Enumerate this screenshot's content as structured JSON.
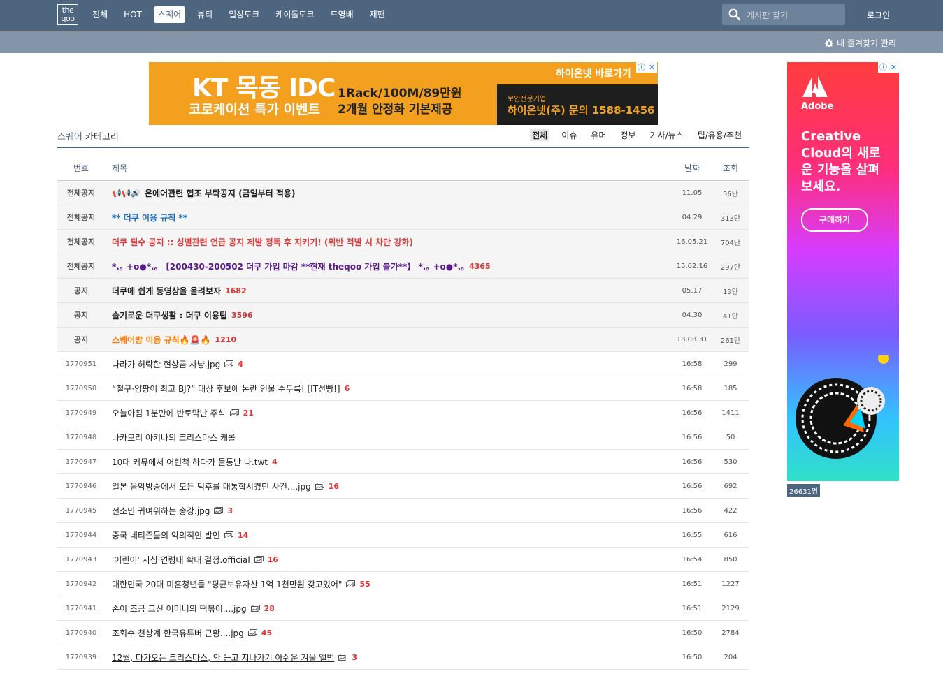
{
  "header": {
    "logo_text": "the qoo",
    "nav": [
      {
        "label": "전체",
        "active": false
      },
      {
        "label": "HOT",
        "active": false
      },
      {
        "label": "스퀘어",
        "active": true
      },
      {
        "label": "뷰티",
        "active": false
      },
      {
        "label": "일상토크",
        "active": false
      },
      {
        "label": "케이돌토크",
        "active": false
      },
      {
        "label": "드영배",
        "active": false
      },
      {
        "label": "재팬",
        "active": false
      }
    ],
    "search_placeholder": "게시판 찾기",
    "login": "로그인",
    "favorites": "내 즐겨찾기 관리"
  },
  "ad_banner": {
    "headline": "KT 목동 IDC",
    "subline": "코로케이션 특가 이벤트",
    "offer_line1": "1Rack/100M/89만원",
    "offer_line2": "2개월 안정화 기본제공",
    "goto": "하이온넷 바로가기",
    "company_tag": "보안전문기업",
    "contact": "하이온넷(주) 문의 1588-1456"
  },
  "category": {
    "title_prefix": "스퀘어",
    "title_suffix": "카테고리",
    "tabs": [
      "전체",
      "이슈",
      "유머",
      "정보",
      "기사/뉴스",
      "팁/유용/추천"
    ],
    "active_tab": "전체"
  },
  "board": {
    "columns": {
      "no": "번호",
      "title": "제목",
      "date": "날짜",
      "views": "조회"
    },
    "rows": [
      {
        "no": "전체공지",
        "notice": true,
        "prefix": "📢📢🔊",
        "title": "온에어관련 협조 부탁공지 (금일부터 적용)",
        "color": "#222",
        "bold": true,
        "img": false,
        "comments": "",
        "date": "11.05",
        "views": "56만"
      },
      {
        "no": "전체공지",
        "notice": true,
        "prefix": "",
        "title": "** 더쿠 이용 규칙 **",
        "color": "#1a6fc4",
        "bold": true,
        "img": false,
        "comments": "",
        "date": "04.29",
        "views": "313만"
      },
      {
        "no": "전체공지",
        "notice": true,
        "prefix": "",
        "title": "더쿠 필수 공지 :: 성별관련 언급 공지 제발 정독 후 지키기! (위반 적발 시 차단 강화)",
        "color": "#e03a3a",
        "bold": true,
        "img": false,
        "comments": "",
        "date": "16.05.21",
        "views": "704만"
      },
      {
        "no": "전체공지",
        "notice": true,
        "prefix": "",
        "title": "*.｡ +o●*.｡ 【200430-200502 더쿠 가입 마감 **현재 theqoo 가입 불가**】 *.｡ +o●*.｡",
        "color": "#5a1a8c",
        "bold": true,
        "img": false,
        "comments": "4365",
        "date": "15.02.16",
        "views": "297만"
      },
      {
        "no": "공지",
        "notice": true,
        "prefix": "",
        "title": "더쿠에 쉽게 동영상을 올려보자",
        "color": "#222",
        "bold": true,
        "img": false,
        "comments": "1682",
        "date": "05.17",
        "views": "13만"
      },
      {
        "no": "공지",
        "notice": true,
        "prefix": "",
        "title": "슬기로운 더쿠생활 : 더쿠 이용팁",
        "color": "#222",
        "bold": true,
        "img": false,
        "comments": "3596",
        "date": "04.30",
        "views": "41만"
      },
      {
        "no": "공지",
        "notice": true,
        "prefix": "",
        "title": "스퀘어방 이용 규칙🔥🚨🔥",
        "color": "#ff7a00",
        "bold": true,
        "img": false,
        "comments": "1210",
        "date": "18.08.31",
        "views": "261만"
      },
      {
        "no": "1770951",
        "notice": false,
        "prefix": "",
        "title": "나라가 허락한 현상금 사냥.jpg",
        "color": "#222",
        "bold": false,
        "img": true,
        "comments": "4",
        "date": "16:58",
        "views": "299"
      },
      {
        "no": "1770950",
        "notice": false,
        "prefix": "",
        "title": "“철구·양팡이 최고 BJ?” 대상 후보에 논란 인물 수두룩! [IT선빵!]",
        "color": "#222",
        "bold": false,
        "img": false,
        "comments": "6",
        "date": "16:58",
        "views": "185"
      },
      {
        "no": "1770949",
        "notice": false,
        "prefix": "",
        "title": "오늘아침 1분만에 반토막난 주식",
        "color": "#222",
        "bold": false,
        "img": true,
        "comments": "21",
        "date": "16:56",
        "views": "1411"
      },
      {
        "no": "1770948",
        "notice": false,
        "prefix": "",
        "title": "나카모리 아키나의 크리스마스 캐롤",
        "color": "#222",
        "bold": false,
        "img": false,
        "comments": "",
        "date": "16:56",
        "views": "50"
      },
      {
        "no": "1770947",
        "notice": false,
        "prefix": "",
        "title": "10대 커뮤에서 어린척 하다가 들통난 나.twt",
        "color": "#222",
        "bold": false,
        "img": false,
        "comments": "4",
        "date": "16:56",
        "views": "530"
      },
      {
        "no": "1770946",
        "notice": false,
        "prefix": "",
        "title": "일본 음악방송에서 모든 덕후를 대통합시켰던 사건....jpg",
        "color": "#222",
        "bold": false,
        "img": true,
        "comments": "16",
        "date": "16:56",
        "views": "692"
      },
      {
        "no": "1770945",
        "notice": false,
        "prefix": "",
        "title": "전소민 귀여워하는 송강.jpg",
        "color": "#222",
        "bold": false,
        "img": true,
        "comments": "3",
        "date": "16:56",
        "views": "422"
      },
      {
        "no": "1770944",
        "notice": false,
        "prefix": "",
        "title": "중국 네티즌들의 악의적인 발언",
        "color": "#222",
        "bold": false,
        "img": true,
        "comments": "14",
        "date": "16:55",
        "views": "616"
      },
      {
        "no": "1770943",
        "notice": false,
        "prefix": "",
        "title": "'어린이' 지칭 연령대 확대 결정.official",
        "color": "#222",
        "bold": false,
        "img": true,
        "comments": "16",
        "date": "16:54",
        "views": "850"
      },
      {
        "no": "1770942",
        "notice": false,
        "prefix": "",
        "title": "대한민국 20대 미혼청년들 \"평균보유자산 1억 1천만원 갖고있어\"",
        "color": "#222",
        "bold": false,
        "img": true,
        "comments": "55",
        "date": "16:51",
        "views": "1227"
      },
      {
        "no": "1770941",
        "notice": false,
        "prefix": "",
        "title": "손이 조금 크신 어머니의 떡볶이....jpg",
        "color": "#222",
        "bold": false,
        "img": true,
        "comments": "28",
        "date": "16:51",
        "views": "2129"
      },
      {
        "no": "1770940",
        "notice": false,
        "prefix": "",
        "title": "조회수 천상계 한국유튜버 근황....jpg",
        "color": "#222",
        "bold": false,
        "img": true,
        "comments": "45",
        "date": "16:50",
        "views": "2784"
      },
      {
        "no": "1770939",
        "notice": false,
        "prefix": "",
        "title": "12월, 다가오는 크리스마스, 안 듣고 지나가기 아쉬운 겨울 앨범",
        "color": "#222",
        "bold": false,
        "img": true,
        "comments": "3",
        "date": "16:50",
        "views": "204",
        "underline": true
      }
    ]
  },
  "side_ad": {
    "brand": "Adobe",
    "copy": "Creative Cloud의 새로운 기능을 살펴보세요.",
    "cta": "구매하기"
  },
  "visitor_count": "26631명",
  "colors": {
    "primary": "#4e6580",
    "subbar": "#8495aa",
    "comment": "#dd3333"
  }
}
